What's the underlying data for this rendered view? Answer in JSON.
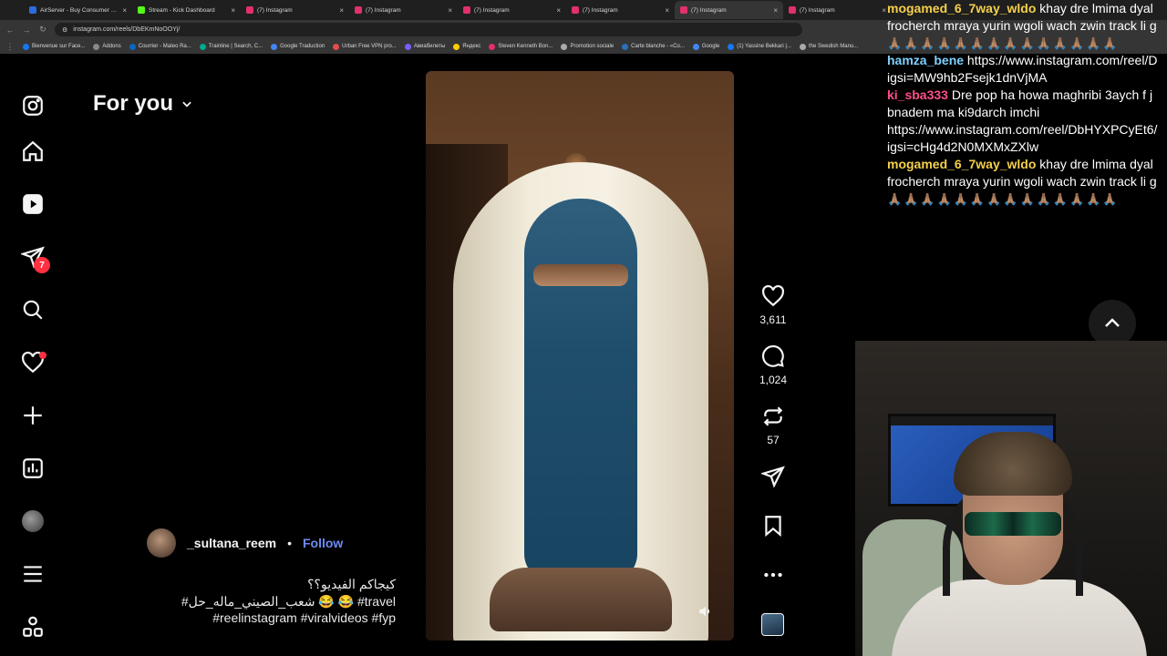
{
  "browser": {
    "tabs": [
      {
        "title": "AirServer - Buy Consumer Lice",
        "color": "#2d6cdf",
        "active": false
      },
      {
        "title": "Stream - Kick Dashboard",
        "color": "#53fc18",
        "active": false
      },
      {
        "title": "(7) Instagram",
        "color": "#e1306c",
        "active": false
      },
      {
        "title": "(7) Instagram",
        "color": "#e1306c",
        "active": false
      },
      {
        "title": "(7) Instagram",
        "color": "#e1306c",
        "active": false
      },
      {
        "title": "(7) Instagram",
        "color": "#e1306c",
        "active": false
      },
      {
        "title": "(7) Instagram",
        "color": "#e1306c",
        "active": true
      },
      {
        "title": "(7) Instagram",
        "color": "#e1306c",
        "active": false
      }
    ],
    "url": "instagram.com/reels/DbEKmNoOOYj/",
    "bookmarks": [
      {
        "label": "Bienvenue sur Face...",
        "color": "#1877f2"
      },
      {
        "label": "Addons",
        "color": "#888888"
      },
      {
        "label": "Courrier - Mateo Ra...",
        "color": "#0a66c2"
      },
      {
        "label": "Trainline | Search, C...",
        "color": "#00a88f"
      },
      {
        "label": "Google Traduction",
        "color": "#4285f4"
      },
      {
        "label": "Urban Free VPN pro...",
        "color": "#e34b4b"
      },
      {
        "label": "Авиабилеты",
        "color": "#7b5cff"
      },
      {
        "label": "Яндекс",
        "color": "#ffcc00"
      },
      {
        "label": "Steven Kenneth Bon...",
        "color": "#e1306c"
      },
      {
        "label": "Promotion sociale",
        "color": "#aaaaaa"
      },
      {
        "label": "Carte blanche - «Co...",
        "color": "#2b6fb8"
      },
      {
        "label": "Google",
        "color": "#4285f4"
      },
      {
        "label": "(1) Yassine Bekkari |...",
        "color": "#1877f2"
      },
      {
        "label": "the Swedish Manu...",
        "color": "#aaaaaa"
      }
    ]
  },
  "instagram": {
    "nav_icons": [
      "instagram-logo-icon",
      "home-icon",
      "reels-icon",
      "messages-icon",
      "search-icon",
      "notifications-icon",
      "create-icon",
      "dashboard-icon",
      "profile-icon",
      "menu-icon",
      "apps-icon"
    ],
    "messages_badge": "7",
    "feed_title": "For you",
    "reel": {
      "author": "_sultana_reem",
      "separator": "•",
      "follow_label": "Follow",
      "caption_line1": "كيجاكم الفيديو؟؟",
      "caption_line2": "#شعب_الصيني_ماله_حل 😂 😂 #travel",
      "caption_line3": "#reelinstagram #viralvideos #fyp",
      "likes": "3,611",
      "comments": "1,024",
      "reposts": "57",
      "more_label": "..."
    }
  },
  "chat": {
    "messages": [
      {
        "user": "mogamed_6_7way_wldo",
        "color_class": "u1",
        "text": " khay dre lmima dyal",
        "cont": "frocherch mraya yurin wgoli wach zwin track li g",
        "emojis": "🙏🏽🙏🏽🙏🏽🙏🏽🙏🏽🙏🏽🙏🏽🙏🏽🙏🏽🙏🏽🙏🏽🙏🏽🙏🏽🙏🏽"
      },
      {
        "user": "hamza_bene",
        "color_class": "u2",
        "text": " https://www.instagram.com/reel/D",
        "cont": "igsi=MW9hb2Fsejk1dnVjMA",
        "emojis": ""
      },
      {
        "user": "ki_sba333",
        "color_class": "u3",
        "text": " Dre pop ha howa maghribi 3aych f j",
        "cont": "bnadem ma ki9darch imchi",
        "cont2": "https://www.instagram.com/reel/DbHYXPCyEt6/",
        "cont3": "igsi=cHg4d2N0MXMxZXlw",
        "emojis": ""
      },
      {
        "user": "mogamed_6_7way_wldo",
        "color_class": "u1",
        "text": " khay dre lmima dyal",
        "cont": "frocherch mraya yurin wgoli wach zwin track li g",
        "emojis": "🙏🏽🙏🏽🙏🏽🙏🏽🙏🏽🙏🏽🙏🏽🙏🏽🙏🏽🙏🏽🙏🏽🙏🏽🙏🏽🙏🏽"
      }
    ]
  }
}
